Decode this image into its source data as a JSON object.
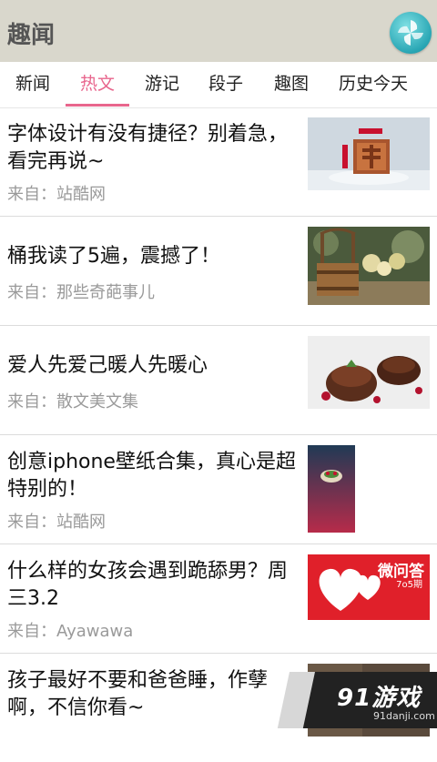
{
  "header": {
    "title": "趣闻",
    "logo_icon": "pinwheel-logo-icon"
  },
  "tabs": [
    {
      "label": "新闻",
      "active": false
    },
    {
      "label": "热文",
      "active": true
    },
    {
      "label": "游记",
      "active": false
    },
    {
      "label": "段子",
      "active": false
    },
    {
      "label": "趣图",
      "active": false
    },
    {
      "label": "历史今天",
      "active": false
    }
  ],
  "articles": [
    {
      "title": "字体设计有没有捷径？别着急，看完再说~",
      "source": "来自：站酷网",
      "thumb": "fu-character-3d-image"
    },
    {
      "title": "桶我读了5遍，震撼了！",
      "source": "来自：那些奇葩事儿",
      "thumb": "wooden-bucket-flowers-image"
    },
    {
      "title": "爱人先爱己暖人先暖心",
      "source": "来自：散文美文集",
      "thumb": "chocolate-dessert-image"
    },
    {
      "title": "创意iphone壁纸合集，真心是超特别的！",
      "source": "来自：站酷网",
      "thumb": "iphone-wallpaper-image"
    },
    {
      "title": "什么样的女孩会遇到跪舔男？周三3.2",
      "source": "来自：Ayawawa",
      "thumb": "hearts-weiwenda-image",
      "thumb_text": "微问答",
      "thumb_sub": "7o5期"
    },
    {
      "title": "孩子最好不要和爸爸睡，作孽啊，不信你看~",
      "source": "",
      "thumb": "partial-photo-image"
    }
  ],
  "watermark": {
    "text": "91游戏",
    "url": "91danji.com"
  },
  "colors": {
    "header_bg": "#d9d7cc",
    "accent": "#e8668d",
    "source_text": "#9a9a9a"
  }
}
